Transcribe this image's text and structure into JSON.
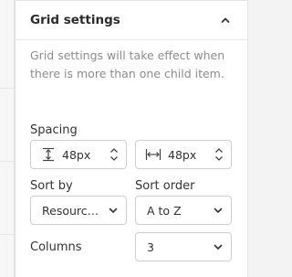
{
  "grid_settings": {
    "title": "Grid settings",
    "description": "Grid settings will take effect when there is more than one child item.",
    "spacing": {
      "label": "Spacing",
      "vertical_value": "48px",
      "horizontal_value": "48px"
    },
    "sort_by": {
      "label": "Sort by",
      "value": "Resourc…"
    },
    "sort_order": {
      "label": "Sort order",
      "value": "A to Z"
    },
    "columns": {
      "label": "Columns",
      "value": "3"
    }
  },
  "icons": {
    "collapse": "chevron-up-icon",
    "vertical_spacing": "vertical-spacing-icon",
    "horizontal_spacing": "horizontal-spacing-icon",
    "stepper": "stepper-updown-icon",
    "dropdown": "chevron-down-icon"
  },
  "colors": {
    "panel_bg": "#ffffff",
    "border": "#cfcfd3",
    "muted_text": "#8c8c8c",
    "text": "#2b2b2b"
  }
}
